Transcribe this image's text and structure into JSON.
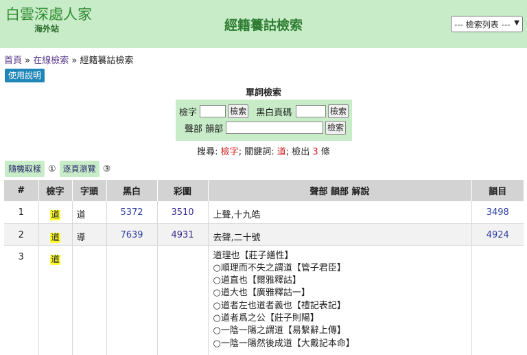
{
  "header": {
    "logo_text": "白雲深處人家",
    "logo_sub": "海外站",
    "title": "經籍籑詁檢索",
    "select_value": "--- 檢索列表 ---"
  },
  "breadcrumb": {
    "home": "首頁",
    "sep": "»",
    "online": "在線檢索",
    "current": "經籍籑詁檢索"
  },
  "help_button": "使用說明",
  "search": {
    "title": "單詞檢索",
    "char_label": "檢字",
    "page_label": "黑白頁碼",
    "rhyme_label": "聲部 韻部",
    "button": "檢索"
  },
  "summary": {
    "prefix": "搜尋:",
    "query": "檢字",
    "keyword_label": "關鍵詞:",
    "keyword": "道",
    "count_label": "檢出",
    "count": "3",
    "unit": "條"
  },
  "nav": {
    "random": "隨機取樣",
    "browse": "逐頁瀏覽",
    "circle1": "①",
    "circle3": "③"
  },
  "table": {
    "headers": {
      "num": "#",
      "char": "檢字",
      "head": "字頭",
      "bw": "黑白",
      "color": "彩圖",
      "desc": "聲部 韻部 解說",
      "rhyme": "韻目"
    },
    "rows": [
      {
        "num": "1",
        "char": "道",
        "head": "道",
        "bw": "5372",
        "color": "3510",
        "desc": "上聲,十九皓",
        "rhyme": "3498"
      },
      {
        "num": "2",
        "char": "道",
        "head": "導",
        "bw": "7639",
        "color": "4931",
        "desc": "去聲,二十號",
        "rhyme": "4924"
      },
      {
        "num": "3",
        "char": "道",
        "head": "",
        "bw": "",
        "color": "",
        "desc": "",
        "rhyme": "",
        "lines": [
          "道理也【莊子繕性】",
          "○順理而不失之謂道【管子君臣】",
          "○道直也【爾雅釋詁】",
          "○道大也【廣雅釋詁一】",
          "○道者左也道者義也【禮記表記】",
          "○道者爲之公【莊子則陽】",
          "○一陰一陽之謂道【易繫辭上傳】",
          "○一陰一陽然後成道【大戴記本命】"
        ]
      }
    ]
  }
}
